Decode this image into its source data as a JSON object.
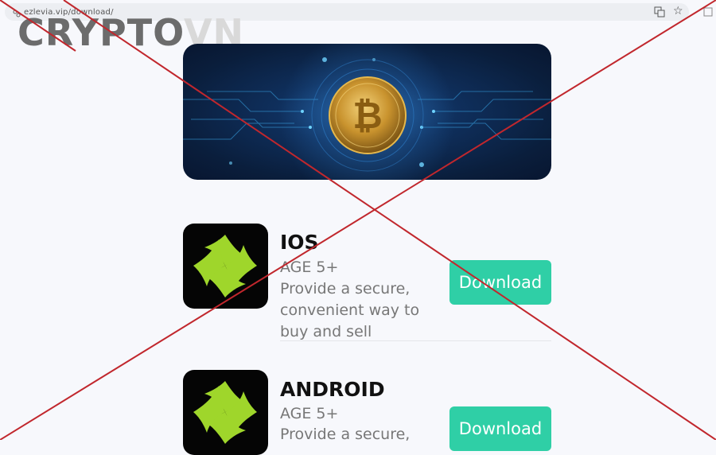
{
  "browser": {
    "url": "ezlevia.vip/download/",
    "icons": [
      "page-info-icon",
      "translate-icon",
      "star-icon",
      "extension-icon"
    ]
  },
  "watermark": {
    "bold": "CRYPTO",
    "light": "VN"
  },
  "hero": {
    "image": "bitcoin-circuit-banner",
    "coin_symbol": "₿"
  },
  "apps": [
    {
      "title": "IOS",
      "age": "AGE 5+",
      "desc_lines": [
        "Provide a secure,",
        "convenient way to",
        "buy and sell"
      ],
      "button": "Download"
    },
    {
      "title": "ANDROID",
      "age": "AGE 5+",
      "desc_lines": [
        "Provide a secure,"
      ],
      "button": "Download"
    }
  ],
  "colors": {
    "button": "#2fcfa6",
    "app_icon_bg": "#050505",
    "app_icon_leaf": "#9fd62b",
    "cross": "#c1272d"
  }
}
